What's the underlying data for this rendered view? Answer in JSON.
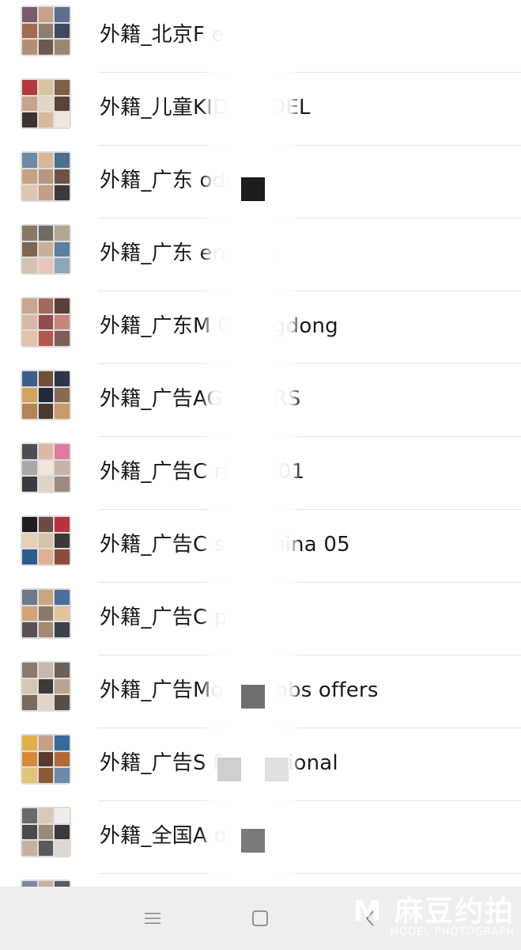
{
  "groups": [
    {
      "name": "外籍_北京F          e jobs",
      "avatar": [
        "#7a5b6b",
        "#c9a08a",
        "#5e6e8c",
        "#a06b4f",
        "#8d7f73",
        "#3f4a5e",
        "#b58f6f",
        "#6c5a4d",
        "#9b8675"
      ]
    },
    {
      "name": "外籍_儿童KID  MODEL",
      "avatar": [
        "#b13a3a",
        "#d9c2a0",
        "#7d5f4a",
        "#c8a48c",
        "#e2d6c6",
        "#5a4438",
        "#3b3331",
        "#d7b8a0",
        "#efe7df"
      ]
    },
    {
      "name": "外籍_广东        odels",
      "avatar": [
        "#6f8aa7",
        "#d8b89a",
        "#4d6f8f",
        "#c8a182",
        "#b9977c",
        "#6e5345",
        "#e0c6b0",
        "#c49e86",
        "#3d3a3a"
      ]
    },
    {
      "name": "外籍_广东        enzhen",
      "avatar": [
        "#8a7766",
        "#6e6a66",
        "#b5a593",
        "#7f6450",
        "#c9b09a",
        "#5b7f9c",
        "#d4c2b0",
        "#e8c4b8",
        "#8fa6b8"
      ]
    },
    {
      "name": "外籍_广东M          Guangdong",
      "avatar": [
        "#c9a58e",
        "#a16a5a",
        "#5a3f3a",
        "#d9b9a6",
        "#8f4d4d",
        "#c7867a",
        "#e2c3ae",
        "#b3584f",
        "#7e5d57"
      ]
    },
    {
      "name": "外籍_广告AG          CTORS",
      "avatar": [
        "#3e5d8c",
        "#6f4f3c",
        "#2f3548",
        "#d2a35a",
        "#1f2a3a",
        "#8a6a52",
        "#b48454",
        "#4a3a30",
        "#c99a6a"
      ]
    },
    {
      "name": "外籍_广告C        rtist N01",
      "avatar": [
        "#4e4e56",
        "#d9b8a6",
        "#e07ba0",
        "#a8a8a8",
        "#f0e6dc",
        "#c6b4a6",
        "#3a3a42",
        "#e2d2c4",
        "#9b8a7e"
      ]
    },
    {
      "name": "外籍_广告C         s in China 05",
      "avatar": [
        "#1e1e22",
        "#6c4c44",
        "#b8323e",
        "#e8d0b8",
        "#d6c2a8",
        "#3c3834",
        "#2f5c8c",
        "#e0b090",
        "#8c4c3c"
      ]
    },
    {
      "name": "外籍_广告C         pou⑦",
      "avatar": [
        "#6c7a8a",
        "#c7a57e",
        "#4d6d9c",
        "#d4a274",
        "#8a7a6a",
        "#e0c49c",
        "#5a5058",
        "#a48874",
        "#3c4048"
      ]
    },
    {
      "name": "外籍_广告Mo     ing jobs offers",
      "avatar": [
        "#8a7a70",
        "#c9b8a8",
        "#6a6258",
        "#d8c6b4",
        "#3e3a36",
        "#b8a490",
        "#7a6a5e",
        "#e2d4c6",
        "#5a4e46"
      ]
    },
    {
      "name": "外籍_广告S         Professional",
      "avatar": [
        "#e2b04a",
        "#c4a08a",
        "#3a6a9c",
        "#d88a3a",
        "#5a3a2a",
        "#b06a3a",
        "#e2c47a",
        "#8a5a3a",
        "#6c8aa8"
      ]
    },
    {
      "name": "外籍_全国A         odel",
      "avatar": [
        "#6a6a6a",
        "#d8c8b8",
        "#f0ece8",
        "#4a4a4a",
        "#9a8a7a",
        "#3a3a3a",
        "#c8b0a0",
        "#5a5a5a",
        "#e0d8d0"
      ]
    },
    {
      "name": "",
      "avatar": [
        "#7a8aa0",
        "#c8b09a",
        "#5a5a6a",
        "#b89a86",
        "#8a7a6a",
        "#4a4a54",
        "#d8c0a8",
        "#6a5a50",
        "#a08a7a"
      ]
    }
  ],
  "nav": {
    "menu_icon": "menu-icon",
    "home_icon": "square-home-icon",
    "back_icon": "chevron-left-back-icon"
  },
  "watermark": {
    "main": "M 麻豆约拍",
    "sub": "MODEL PHOTOGRAPH"
  },
  "colors": {
    "background": "#ffffff",
    "text": "#1a1a1a",
    "divider": "#e6e6e6",
    "navbar": "#eeeeee",
    "nav_icon": "#8a8a8a"
  }
}
